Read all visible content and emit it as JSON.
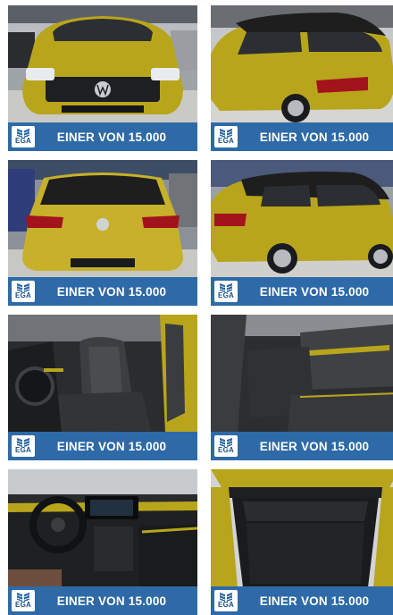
{
  "logo": {
    "text": "EGA"
  },
  "banner_text": "EINER VON 15.000",
  "colors": {
    "banner": "#2e6aa7",
    "car_paint": "#b8a51c",
    "roof": "#1e1e1e"
  },
  "tiles": [
    {
      "view": "front",
      "banner": "EINER VON 15.000"
    },
    {
      "view": "rear-three-quarter",
      "banner": "EINER VON 15.000"
    },
    {
      "view": "rear",
      "banner": "EINER VON 15.000"
    },
    {
      "view": "side-rear",
      "banner": "EINER VON 15.000"
    },
    {
      "view": "front-seats",
      "banner": "EINER VON 15.000"
    },
    {
      "view": "rear-seats",
      "banner": "EINER VON 15.000"
    },
    {
      "view": "dashboard",
      "banner": "EINER VON 15.000"
    },
    {
      "view": "trunk",
      "banner": "EINER VON 15.000"
    }
  ]
}
